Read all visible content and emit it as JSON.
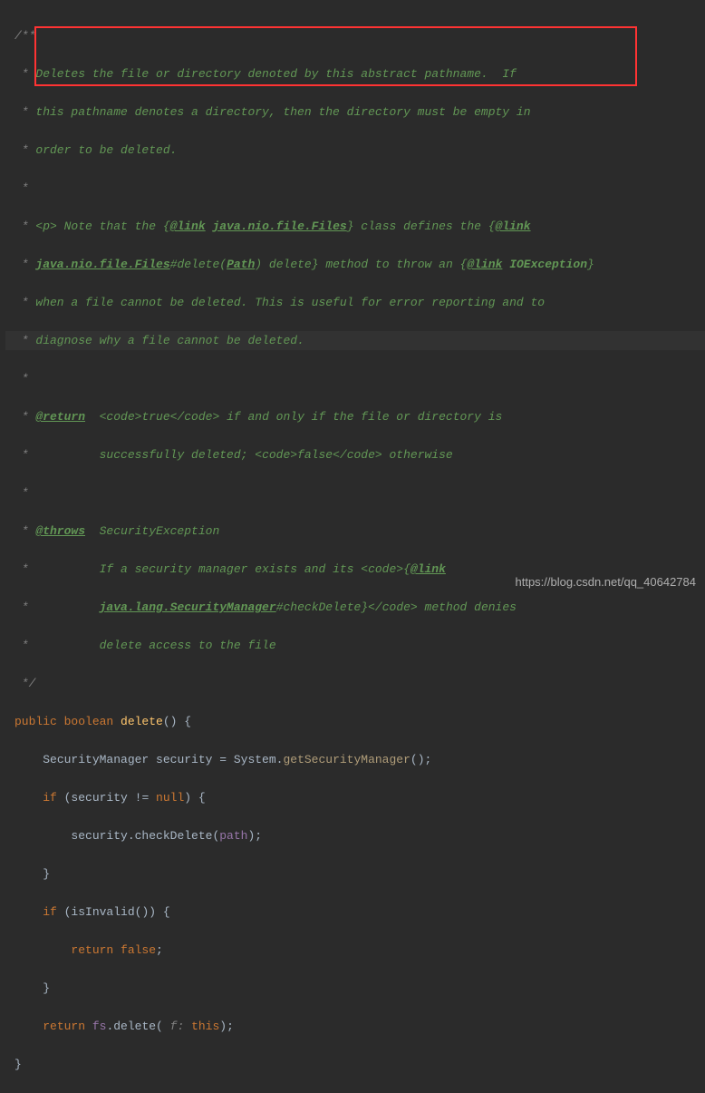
{
  "code": {
    "l1": "/**",
    "l2_pre": " * ",
    "l2_txt": "Deletes the file or directory denoted by this abstract pathname.  If",
    "l3_pre": " * ",
    "l3_txt": "this pathname denotes a directory, then the directory must be empty in",
    "l4_pre": " * ",
    "l4_txt": "order to be deleted.",
    "l5": " *",
    "l6_pre": " * ",
    "l6_p": "<p>",
    "l6_t1": " Note that the {",
    "l6_link1": "@link",
    "l6_t2": " ",
    "l6_cls": "java.nio.file.Files",
    "l6_t3": "} class defines the {",
    "l6_link2": "@link",
    "l7_pre": " * ",
    "l7_cls": "java.nio.file.Files",
    "l7_hash": "#",
    "l7_m": "delete",
    "l7_paren": "(",
    "l7_path": "Path",
    "l7_paren2": ")",
    "l7_t1": " delete} method to throw an {",
    "l7_link": "@link",
    "l7_t2": " ",
    "l7_ioe": "IOException",
    "l7_t3": "}",
    "l8_pre": " * ",
    "l8_txt": "when a file cannot be deleted. This is useful for error reporting and to",
    "l9_pre": " * ",
    "l9_txt": "diagnose why a file cannot be deleted.",
    "l10": " *",
    "l11_pre": " * ",
    "l11_ret": "@return",
    "l11_t1": "  ",
    "l11_code": "<code>",
    "l11_true": "true",
    "l11_code2": "</code>",
    "l11_t2": " if and only if the file or directory is",
    "l12_pre": " *          ",
    "l12_t1": "successfully deleted; ",
    "l12_code": "<code>",
    "l12_false": "false",
    "l12_code2": "</code>",
    "l12_t2": " otherwise",
    "l13": " *",
    "l14_pre": " * ",
    "l14_thr": "@throws",
    "l14_t1": "  SecurityException",
    "l15_pre": " *          ",
    "l15_t1": "If a security manager exists and its ",
    "l15_code": "<code>",
    "l15_t2": "{",
    "l15_link": "@link",
    "l16_pre": " *          ",
    "l16_cls": "java.lang.SecurityManager",
    "l16_hash": "#",
    "l16_m": "checkDelete",
    "l16_t1": "}",
    "l16_code": "</code>",
    "l16_t2": " method denies",
    "l17_pre": " *          ",
    "l17_txt": "delete access to the file",
    "l18": " */",
    "l19_pub": "public ",
    "l19_bool": "boolean ",
    "l19_del": "delete",
    "l19_paren": "() {",
    "l20_ind": "    ",
    "l20_t1": "SecurityManager security = System.",
    "l20_m": "getSecurityManager",
    "l20_t2": "();",
    "l21_ind": "    ",
    "l21_if": "if ",
    "l21_t1": "(security != ",
    "l21_null": "null",
    "l21_t2": ") {",
    "l22_ind": "        ",
    "l22_t1": "security.checkDelete(",
    "l22_path": "path",
    "l22_t2": ");",
    "l23_ind": "    ",
    "l23_brace": "}",
    "l24_ind": "    ",
    "l24_if": "if ",
    "l24_t1": "(isInvalid()) {",
    "l25_ind": "        ",
    "l25_ret": "return ",
    "l25_false": "false",
    "l25_semi": ";",
    "l26_ind": "    ",
    "l26_brace": "}",
    "l27_ind": "    ",
    "l27_ret": "return ",
    "l27_fs": "fs",
    "l27_t1": ".delete(",
    "l27_hint": " f: ",
    "l27_this": "this",
    "l27_t2": ");",
    "l28": "}"
  },
  "watermark": "https://blog.csdn.net/qq_40642784"
}
